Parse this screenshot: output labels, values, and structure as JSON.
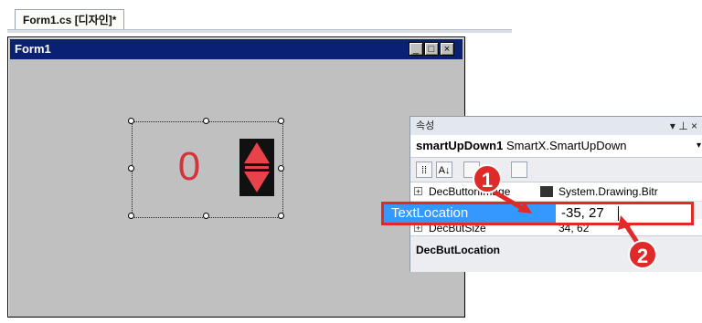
{
  "editor_tab": {
    "label": "Form1.cs [디자인]*"
  },
  "form": {
    "title": "Form1",
    "minimize_glyph": "_",
    "maximize_glyph": "□",
    "close_glyph": "×"
  },
  "control": {
    "value": "0"
  },
  "properties": {
    "panel_title": "속성",
    "panel_controls": "▾ ⊥ ×",
    "object_name": "smartUpDown1",
    "object_type": "SmartX.SmartUpDown",
    "object_dropdown": "▾",
    "toolbar": {
      "categorized": "⁞⁞",
      "alphabetical": "A↓"
    },
    "rows": [
      {
        "name": "DecButtonImage",
        "value": "System.Drawing.Bitr"
      },
      {
        "name": "DecButSize",
        "value": "34, 62"
      }
    ],
    "selected_row": {
      "name": "TextLocation",
      "value": "-35, 27"
    },
    "description_title": "DecButLocation"
  },
  "annotations": {
    "step1": "1",
    "step2": "2"
  },
  "colors": {
    "highlight": "#e02a2a",
    "selection": "#3399ff",
    "titlebar": "#0a2074",
    "counter": "#d4333b"
  }
}
